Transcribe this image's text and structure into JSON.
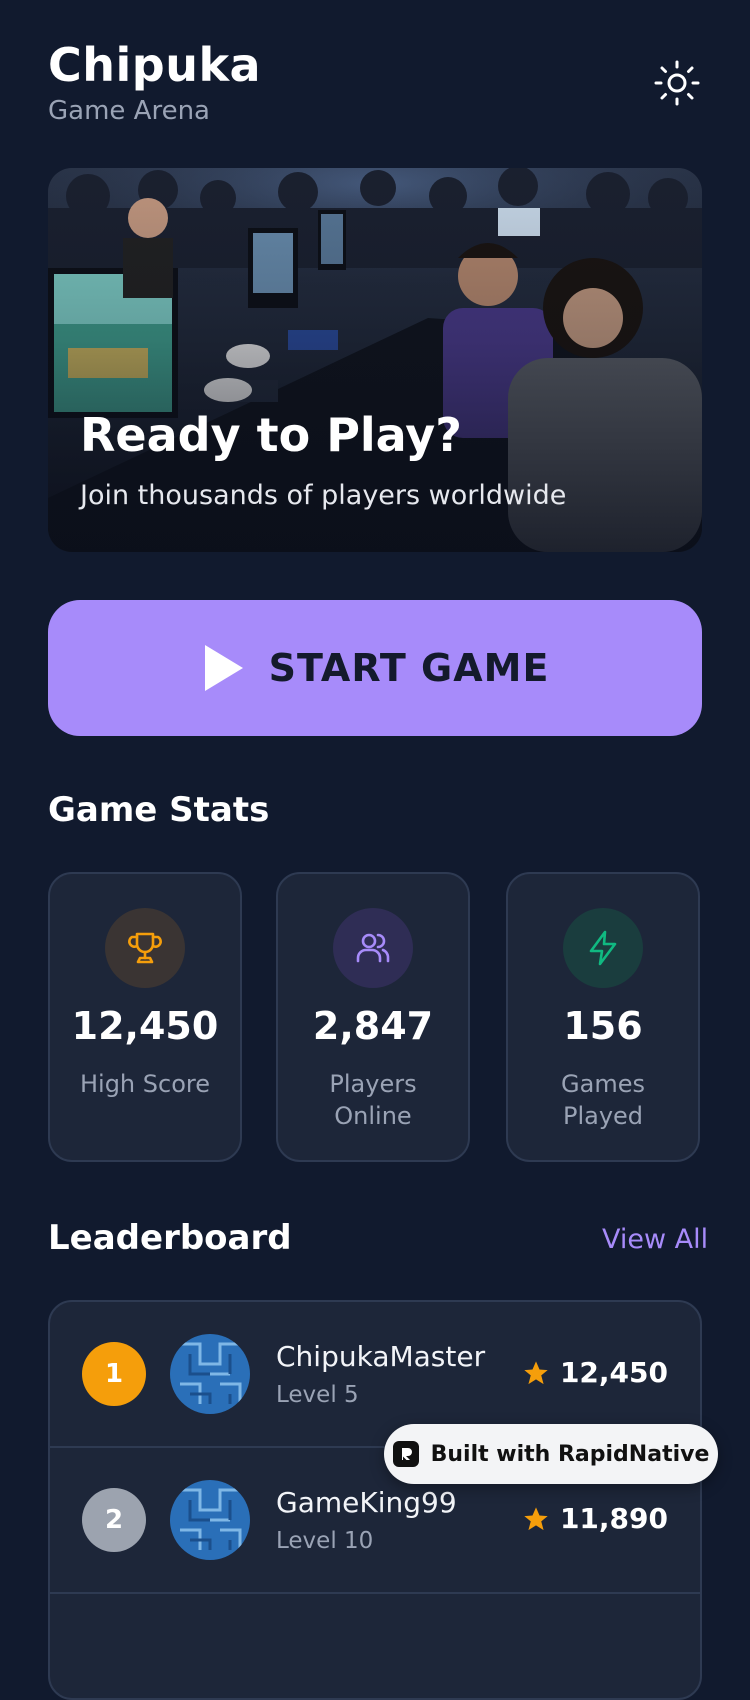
{
  "header": {
    "title": "Chipuka",
    "subtitle": "Game Arena"
  },
  "hero": {
    "title": "Ready to Play?",
    "subtitle": "Join thousands of players worldwide"
  },
  "start_button": {
    "label": "START GAME"
  },
  "stats": {
    "section_title": "Game Stats",
    "items": [
      {
        "value": "12,450",
        "label": "High Score",
        "icon": "trophy-icon",
        "color": "#f59e0b"
      },
      {
        "value": "2,847",
        "label": "Players Online",
        "icon": "users-icon",
        "color": "#a78bfa"
      },
      {
        "value": "156",
        "label": "Games Played",
        "icon": "lightning-icon",
        "color": "#10b981"
      }
    ]
  },
  "leaderboard": {
    "section_title": "Leaderboard",
    "view_all": "View All",
    "rows": [
      {
        "rank": "1",
        "name": "ChipukaMaster",
        "level": "Level 5",
        "score": "12,450",
        "rank_color": "#f59e0b"
      },
      {
        "rank": "2",
        "name": "GameKing99",
        "level": "Level 10",
        "score": "11,890",
        "rank_color": "#9ca3af"
      }
    ]
  },
  "badge": {
    "label": "Built with RapidNative"
  },
  "colors": {
    "background": "#111a2e",
    "accent": "#a78bfa",
    "card": "#1d2639",
    "gold": "#f59e0b"
  }
}
